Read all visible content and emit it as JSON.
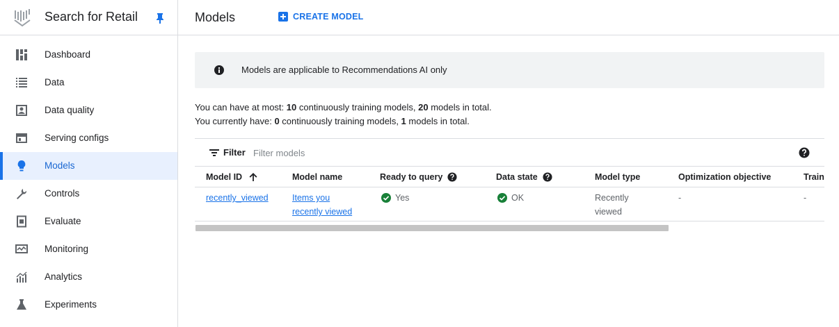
{
  "app": {
    "title": "Search for Retail"
  },
  "sidebar": {
    "items": [
      {
        "label": "Dashboard",
        "icon": "dashboard-icon"
      },
      {
        "label": "Data",
        "icon": "list-icon"
      },
      {
        "label": "Data quality",
        "icon": "data-quality-icon"
      },
      {
        "label": "Serving configs",
        "icon": "serving-configs-icon"
      },
      {
        "label": "Models",
        "icon": "lightbulb-icon",
        "active": true
      },
      {
        "label": "Controls",
        "icon": "wrench-icon"
      },
      {
        "label": "Evaluate",
        "icon": "evaluate-icon"
      },
      {
        "label": "Monitoring",
        "icon": "monitoring-icon"
      },
      {
        "label": "Analytics",
        "icon": "analytics-icon"
      },
      {
        "label": "Experiments",
        "icon": "flask-icon"
      }
    ]
  },
  "header": {
    "page_title": "Models",
    "create_label": "CREATE MODEL"
  },
  "banner": {
    "text": "Models are applicable to Recommendations AI only"
  },
  "limits": {
    "line1_prefix": "You can have at most: ",
    "line1_max_continuous": "10",
    "line1_mid": " continuously training models, ",
    "line1_max_total": "20",
    "line1_suffix": " models in total.",
    "line2_prefix": "You currently have: ",
    "line2_continuous": "0",
    "line2_mid": " continuously training models, ",
    "line2_total": "1",
    "line2_suffix": " models in total."
  },
  "filter": {
    "label": "Filter",
    "placeholder": "Filter models"
  },
  "table": {
    "columns": [
      "Model ID",
      "Model name",
      "Ready to query",
      "Data state",
      "Model type",
      "Optimization objective",
      "Traini"
    ],
    "rows": [
      {
        "model_id": "recently_viewed",
        "model_name_line1": "Items you",
        "model_name_line2": "recently viewed",
        "ready": "Yes",
        "data_state": "OK",
        "type_line1": "Recently",
        "type_line2": "viewed",
        "objective": "-",
        "training": "-"
      }
    ]
  },
  "colors": {
    "accent": "#1a73e8",
    "success": "#188038",
    "active_bg": "#e8f0fe"
  }
}
